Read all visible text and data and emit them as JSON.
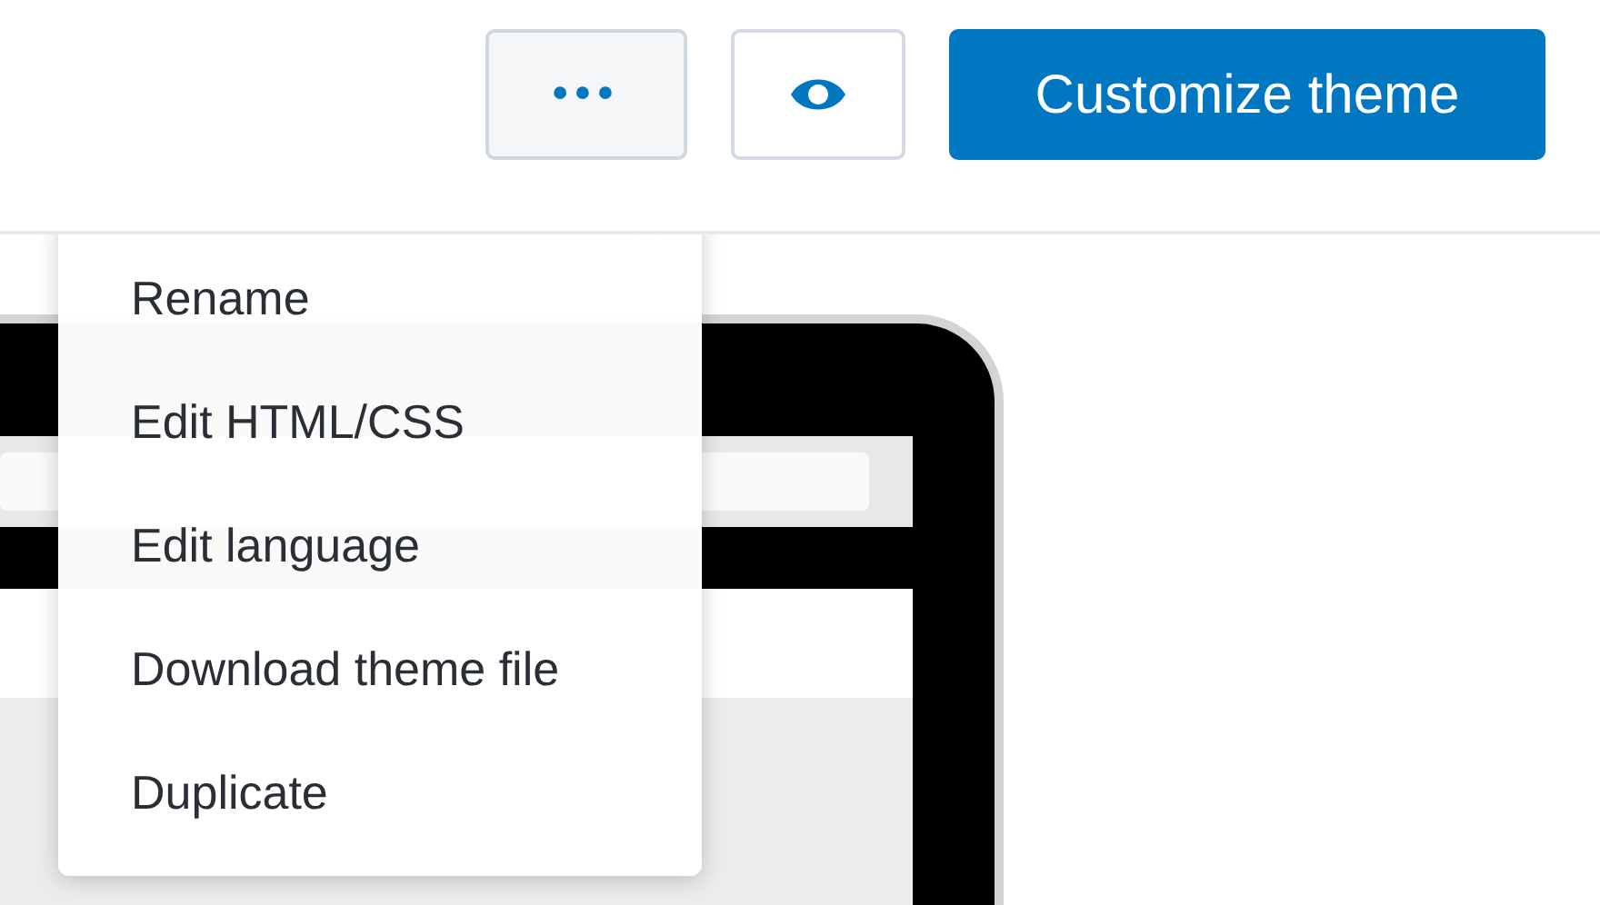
{
  "toolbar": {
    "more_button": {
      "label": "•••",
      "expanded": true
    },
    "customize_button": {
      "label": "Customize theme"
    }
  },
  "menu": {
    "items": [
      {
        "label": "Rename"
      },
      {
        "label": "Edit HTML/CSS"
      },
      {
        "label": "Edit language"
      },
      {
        "label": "Download theme file"
      },
      {
        "label": "Duplicate"
      }
    ]
  }
}
